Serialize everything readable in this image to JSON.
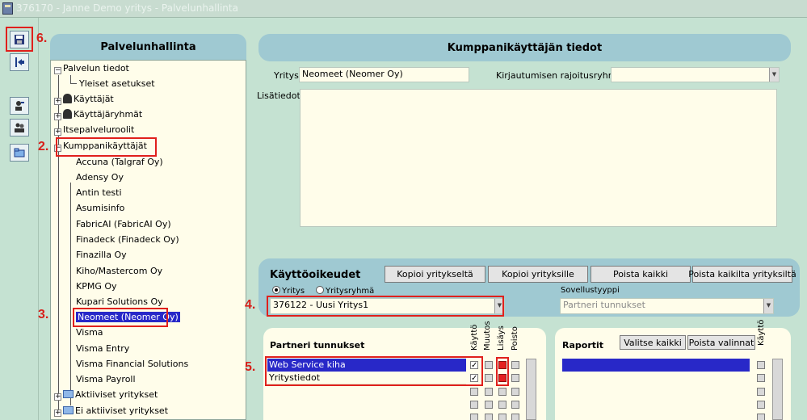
{
  "window": {
    "title": "376170 - Janne Demo yritys - Palvelunhallinta"
  },
  "annotations": {
    "n2": "2.",
    "n3": "3.",
    "n4": "4.",
    "n5": "5.",
    "n6": "6."
  },
  "tree_panel": {
    "heading": "Palvelunhallinta",
    "nodes": {
      "palvelun_tiedot": "Palvelun tiedot",
      "yleiset_asetukset": "Yleiset asetukset",
      "kayttajat": "Käyttäjät",
      "kayttajaryhmat": "Käyttäjäryhmät",
      "itsepalveluroolit": "Itsepalveluroolit",
      "kumppanikayttajat": "Kumppanikäyttäjät",
      "aktiiviset": "Aktiiviset yritykset",
      "ei_aktiiviset": "Ei aktiiviset yritykset"
    },
    "partners": [
      "Accuna (Talgraf Oy)",
      "Adensy Oy",
      "Antin testi",
      "Asumisinfo",
      "FabricAI (FabricAI Oy)",
      "Finadeck (Finadeck Oy)",
      "Finazilla Oy",
      "Kiho/Mastercom Oy",
      "KPMG Oy",
      "Kupari Solutions Oy",
      "Neomeet (Neomer Oy)",
      "Visma",
      "Visma Entry",
      "Visma Financial Solutions",
      "Visma Payroll"
    ],
    "selected_partner": "Neomeet (Neomer Oy)"
  },
  "details": {
    "heading": "Kumppanikäyttäjän tiedot",
    "company_label": "Yritys",
    "company_value": "Neomeet (Neomer Oy)",
    "login_group_label": "Kirjautumisen rajoitusryhmä",
    "login_group_value": "",
    "notes_label": "Lisätiedot",
    "notes_value": ""
  },
  "rights": {
    "heading": "Käyttöoikeudet",
    "buttons": {
      "copy_from": "Kopioi yritykseltä",
      "copy_to": "Kopioi yrityksille",
      "remove_all": "Poista kaikki",
      "remove_all_from": "Poista kaikilta yrityksiltä"
    },
    "radio_company": "Yritys",
    "radio_group": "Yritysryhmä",
    "company_select_value": "376122 - Uusi Yritys1",
    "app_type_label": "Sovellustyyppi",
    "app_type_value": "Partneri tunnukset"
  },
  "partner_ids": {
    "heading": "Partneri tunnukset",
    "columns": [
      "Käyttö",
      "Muutos",
      "Lisäys",
      "Poisto"
    ],
    "rows": [
      {
        "label": "Web Service kiha",
        "kaytto": true,
        "muutos": false,
        "lisays": true,
        "poisto": false
      },
      {
        "label": "Yritystiedot",
        "kaytto": true,
        "muutos": false,
        "lisays": true,
        "poisto": false
      }
    ]
  },
  "reports": {
    "heading": "Raportit",
    "select_all": "Valitse kaikki",
    "clear_selection": "Poista valinnat",
    "column": "Käyttö"
  }
}
